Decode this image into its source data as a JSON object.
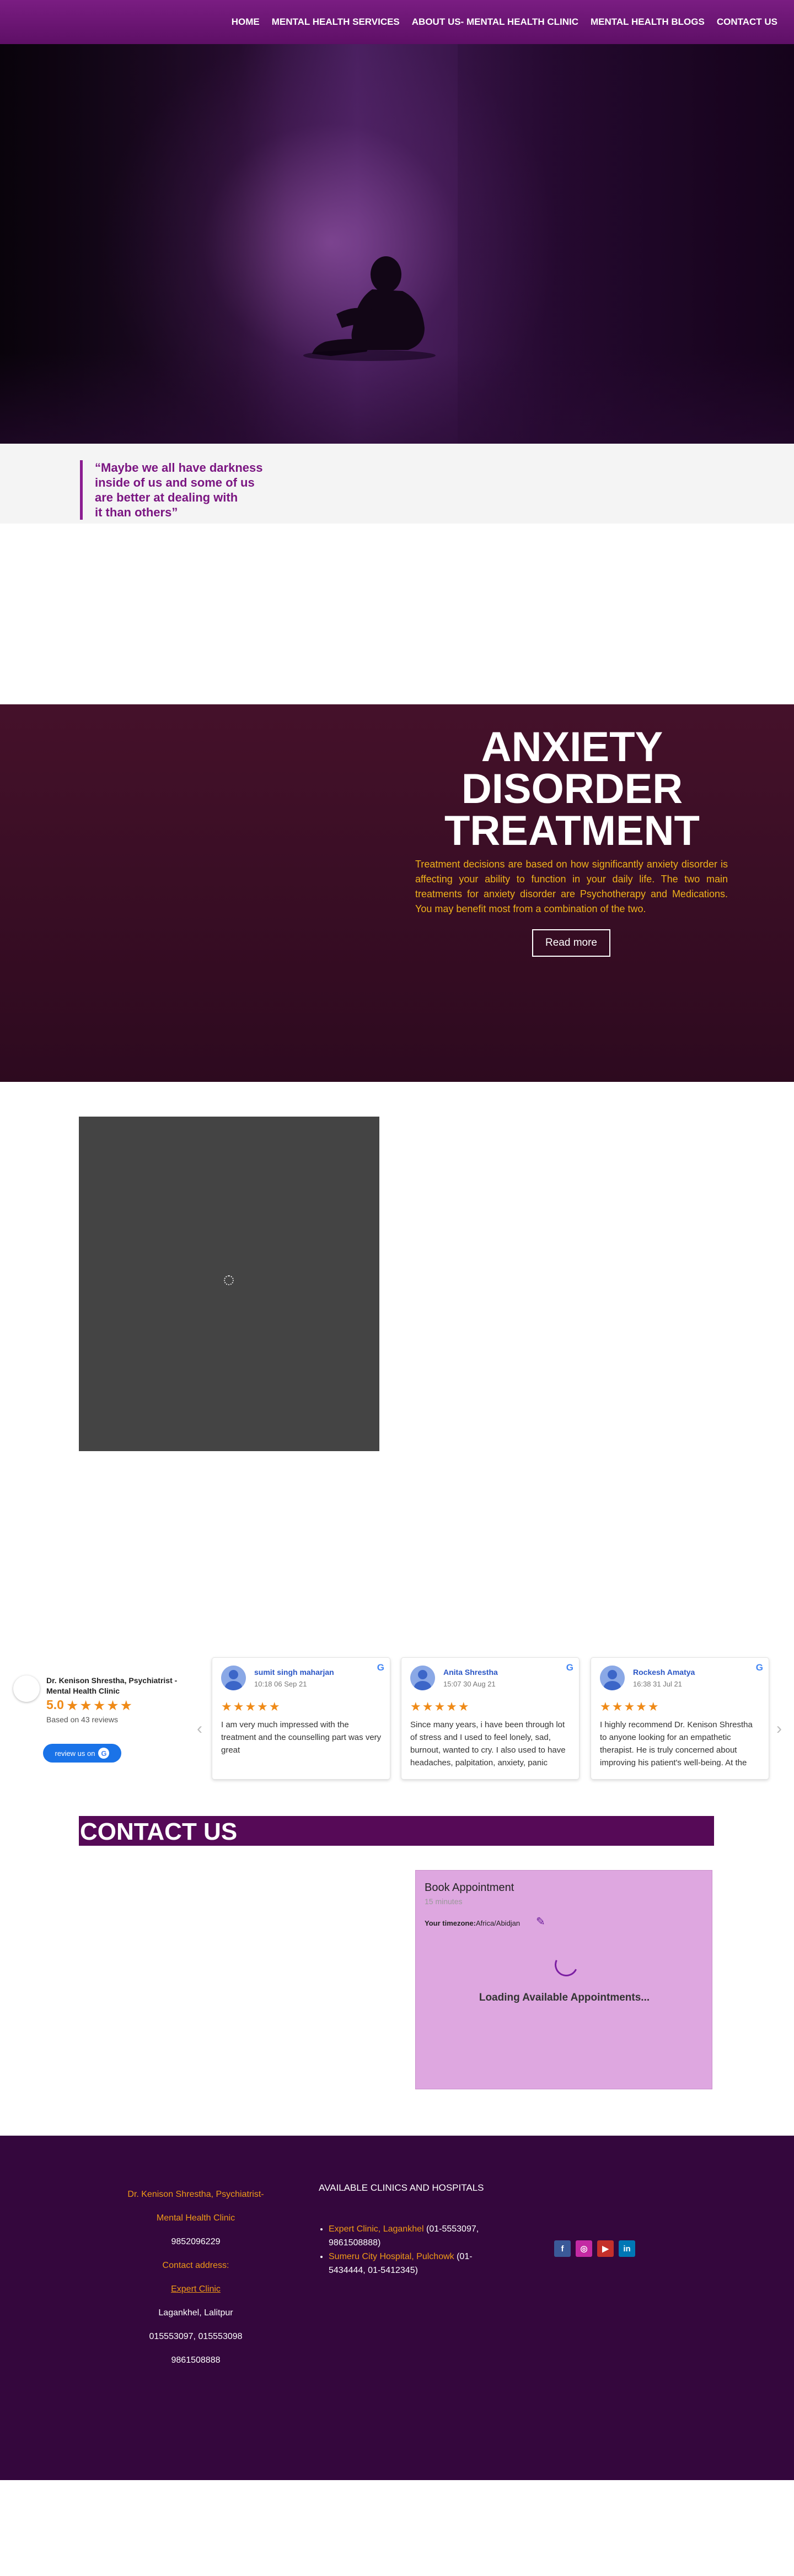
{
  "nav": {
    "items": [
      "HOME",
      "MENTAL HEALTH SERVICES",
      "ABOUT US- MENTAL HEALTH CLINIC",
      "MENTAL HEALTH BLOGS",
      "CONTACT US"
    ]
  },
  "quote": {
    "lines": [
      "“Maybe we all have darkness",
      "inside of us and some of us",
      "are better at dealing with",
      "it than others”"
    ]
  },
  "anxiety": {
    "title_lines": [
      "ANXIETY",
      "DISORDER",
      "TREATMENT"
    ],
    "text": "Treatment decisions are based on how significantly anxiety disorder is affecting your ability to function in your daily life. The two main treatments for anxiety disorder are Psychotherapy and Medications. You may benefit most from a combination of the two.",
    "button": "Read more"
  },
  "reviews": {
    "business_name": "Dr. Kenison Shrestha, Psychiatrist - Mental Health Clinic",
    "rating": "5.0",
    "stars": "★★★★★",
    "based_on": "Based on 43 reviews",
    "review_button": "review us on",
    "prev_arrow": "‹",
    "next_arrow": "›",
    "items": [
      {
        "name": "sumit singh maharjan",
        "date": "10:18 06 Sep 21",
        "stars": "★★★★★",
        "text": "I am very much impressed with the treatment and the counselling part was very great"
      },
      {
        "name": "Anita Shrestha",
        "date": "15:07 30 Aug 21",
        "stars": "★★★★★",
        "text": "Since many years, i have been through lot of stress and I used to feel lonely, sad, burnout, wanted to cry. I also used to have headaches, palpitation, anxiety, panic"
      },
      {
        "name": "Rockesh Amatya",
        "date": "16:38 31 Jul 21",
        "stars": "★★★★★",
        "text": "I highly recommend Dr. Kenison Shrestha to anyone looking for an empathetic therapist. He is truly concerned about improving his patient's well-being. At the"
      }
    ]
  },
  "contact": {
    "title": "CONTACT US",
    "book": {
      "title": "Book Appointment",
      "duration": "15 minutes",
      "timezone_label": "Your timezone:",
      "timezone_value": "Africa/Abidjan",
      "loading": "Loading Available Appointments..."
    }
  },
  "footer": {
    "col1": {
      "name_line1": "Dr. Kenison Shrestha, Psychiatrist-",
      "name_line2": "Mental Health Clinic",
      "phone1": "9852096229",
      "contact_address": "Contact address:",
      "clinic_link": "Expert Clinic",
      "location": "Lagankhel, Lalitpur",
      "phones": "015553097, 015553098",
      "phone2": "9861508888"
    },
    "col2": {
      "heading": "AVAILABLE CLINICS AND HOSPITALS",
      "clinics": [
        {
          "name": "Expert Clinic, Lagankhel",
          "phones": " (01-5553097, 9861508888)"
        },
        {
          "name": "Sumeru City Hospital, Pulchowk",
          "phones": " (01-5434444, 01-5412345)"
        }
      ]
    },
    "socials": [
      {
        "icon": "facebook-icon",
        "glyph": "f",
        "color": "#3b5998"
      },
      {
        "icon": "instagram-icon",
        "glyph": "◎",
        "color": "#c32aa3"
      },
      {
        "icon": "youtube-icon",
        "glyph": "▶",
        "color": "#c4302b"
      },
      {
        "icon": "linkedin-icon",
        "glyph": "in",
        "color": "#0077b5"
      }
    ]
  }
}
